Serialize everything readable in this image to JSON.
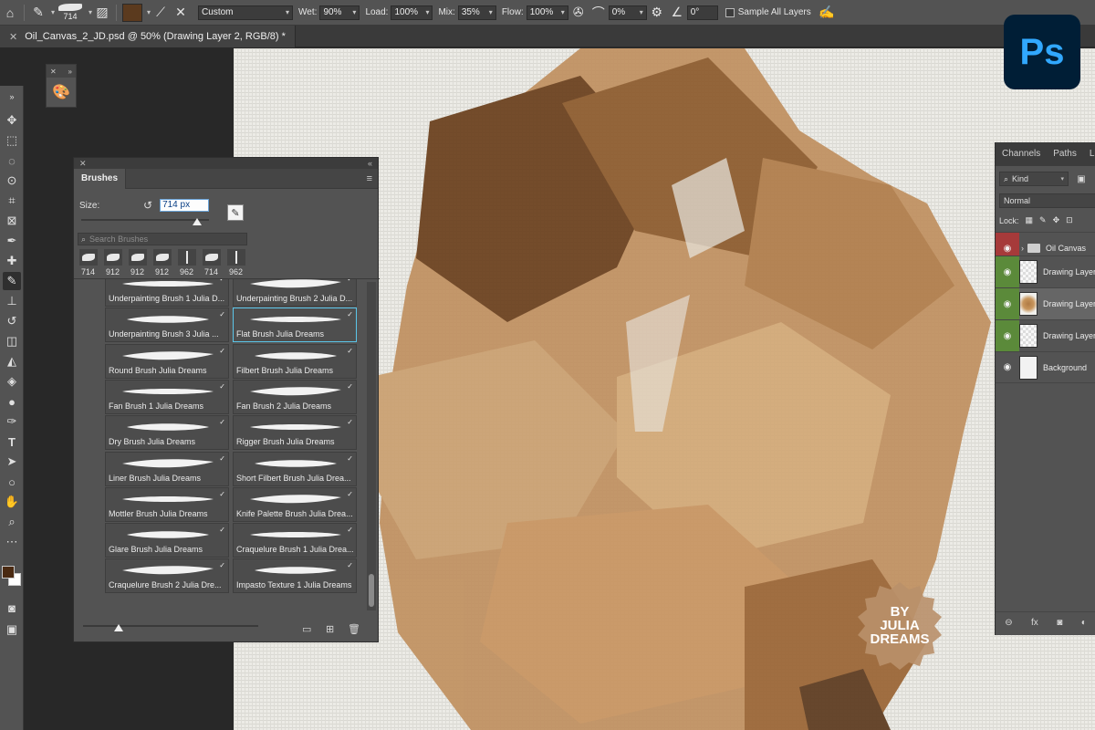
{
  "options_bar": {
    "brush_size": "714",
    "brush_preset": "Custom",
    "wet_label": "Wet:",
    "wet_value": "90%",
    "load_label": "Load:",
    "load_value": "100%",
    "mix_label": "Mix:",
    "mix_value": "35%",
    "flow_label": "Flow:",
    "flow_value": "100%",
    "smoothing_value": "0%",
    "angle_value": "0°",
    "sample_all_layers": "Sample All Layers",
    "paint_color": "#5b3a1e"
  },
  "document": {
    "tab_title": "Oil_Canvas_2_JD.psd @ 50% (Drawing Layer 2, RGB/8) *"
  },
  "toolbar": {
    "tools": [
      "move-icon",
      "marquee-icon",
      "lasso-icon",
      "quick-select-icon",
      "crop-icon",
      "frame-icon",
      "eyedropper-icon",
      "healing-icon",
      "brush-icon",
      "stamp-icon",
      "history-brush-icon",
      "eraser-icon",
      "paint-bucket-icon",
      "blur-icon",
      "dodge-icon",
      "pen-icon",
      "type-icon",
      "path-select-icon",
      "shape-icon",
      "hand-icon",
      "zoom-icon"
    ],
    "foreground_color": "#4a2a12",
    "background_color": "#ffffff"
  },
  "brushes_panel": {
    "tab_label": "Brushes",
    "size_label": "Size:",
    "size_value": "714 px",
    "search_placeholder": "Search Brushes",
    "recent_sizes": [
      "714",
      "912",
      "912",
      "912",
      "962",
      "714",
      "962"
    ],
    "brushes": [
      "Underpainting Brush 1 Julia D...",
      "Underpainting Brush 2 Julia D...",
      "Underpainting Brush 3 Julia ...",
      "Flat Brush Julia Dreams",
      "Round Brush Julia Dreams",
      "Filbert Brush Julia Dreams",
      "Fan Brush 1 Julia Dreams",
      "Fan Brush 2 Julia Dreams",
      "Dry Brush Julia Dreams",
      "Rigger Brush Julia Dreams",
      "Liner Brush Julia Dreams",
      "Short Filbert Brush Julia Drea...",
      "Mottler Brush Julia Dreams",
      "Knife Palette Brush Julia Drea...",
      "Glare Brush Julia Dreams",
      "Craquelure Brush 1 Julia Drea...",
      "Craquelure Brush 2 Julia Dre...",
      "Impasto Texture 1 Julia Dreams"
    ],
    "selected_brush": "Flat Brush Julia Dreams"
  },
  "layers_panel": {
    "tabs": [
      "Channels",
      "Paths",
      "L"
    ],
    "kind_label": "Kind",
    "blend_mode": "Normal",
    "lock_label": "Lock:",
    "layers": [
      {
        "name": "Oil Canvas",
        "type": "group",
        "eye": "red"
      },
      {
        "name": "Drawing Layer",
        "type": "layer",
        "eye": "green"
      },
      {
        "name": "Drawing Layer",
        "type": "layer",
        "eye": "green",
        "selected": true
      },
      {
        "name": "Drawing Layer",
        "type": "layer",
        "eye": "green"
      },
      {
        "name": "Background",
        "type": "background",
        "eye": "none"
      }
    ]
  },
  "app": {
    "logo_text": "Ps",
    "logo_bg": "#001e36",
    "logo_fg": "#31a8ff"
  },
  "watermark": {
    "line1": "BY",
    "line2": "JULIA",
    "line3": "DREAMS"
  }
}
